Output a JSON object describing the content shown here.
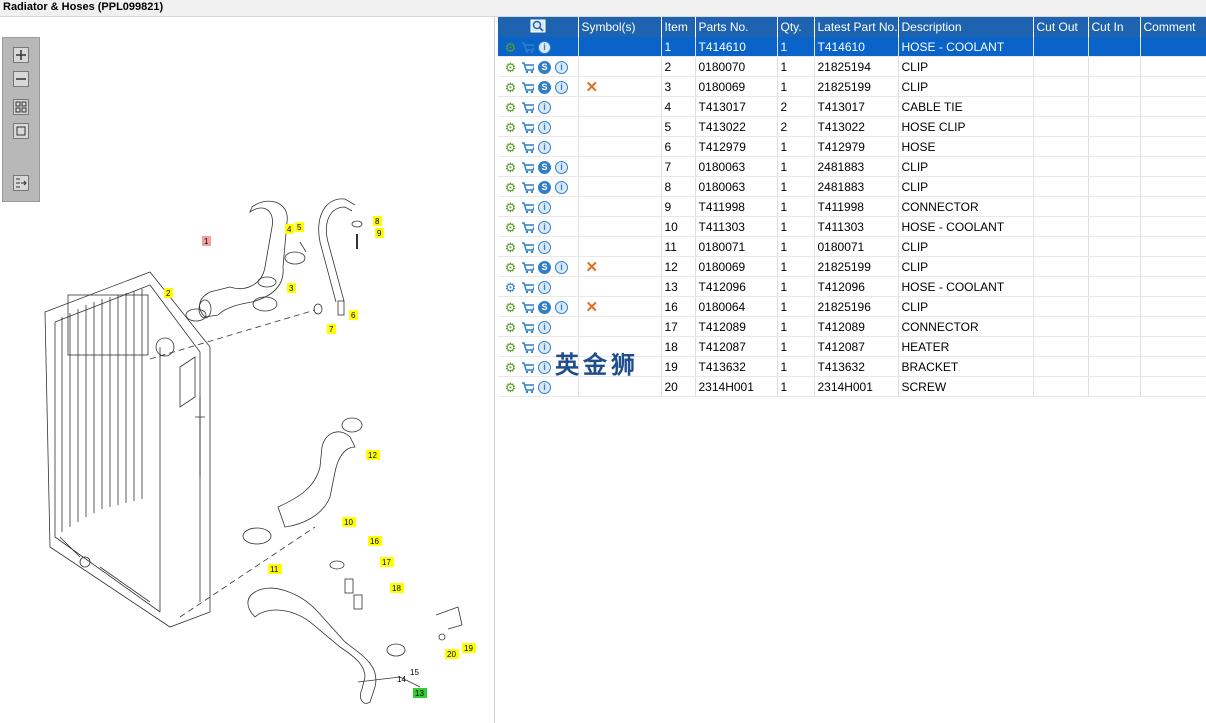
{
  "window": {
    "title": "Radiator & Hoses (PPL099821)"
  },
  "toolbox": [
    {
      "name": "zoom-in-button"
    },
    {
      "name": "zoom-out-button"
    },
    {
      "name": "fit-all-button"
    },
    {
      "name": "actual-size-button"
    },
    {
      "name": "export-button"
    }
  ],
  "drawing": {
    "callouts": [
      "1",
      "2",
      "3",
      "4",
      "5",
      "6",
      "7",
      "8",
      "9",
      "10",
      "11",
      "12",
      "13",
      "14",
      "15",
      "16",
      "17",
      "18",
      "19",
      "20"
    ]
  },
  "table": {
    "columns": [
      "",
      "Symbol(s)",
      "Item",
      "Parts No.",
      "Qty.",
      "Latest Part No.",
      "Description",
      "Cut Out",
      "Cut In",
      "Comment"
    ],
    "rows": [
      {
        "icons": [
          "gear",
          "cart",
          "info"
        ],
        "x": false,
        "item": "1",
        "part": "T414610",
        "qty": "1",
        "latest": "T414610",
        "desc": "HOSE - COOLANT",
        "selected": true
      },
      {
        "icons": [
          "gear",
          "cart",
          "s",
          "info"
        ],
        "x": false,
        "item": "2",
        "part": "0180070",
        "qty": "1",
        "latest": "21825194",
        "desc": "CLIP"
      },
      {
        "icons": [
          "gear",
          "cart",
          "s",
          "info"
        ],
        "x": true,
        "item": "3",
        "part": "0180069",
        "qty": "1",
        "latest": "21825199",
        "desc": "CLIP"
      },
      {
        "icons": [
          "gear",
          "cart",
          "info"
        ],
        "x": false,
        "item": "4",
        "part": "T413017",
        "qty": "2",
        "latest": "T413017",
        "desc": "CABLE TIE"
      },
      {
        "icons": [
          "gear",
          "cart",
          "info"
        ],
        "x": false,
        "item": "5",
        "part": "T413022",
        "qty": "2",
        "latest": "T413022",
        "desc": "HOSE CLIP"
      },
      {
        "icons": [
          "gear",
          "cart",
          "info"
        ],
        "x": false,
        "item": "6",
        "part": "T412979",
        "qty": "1",
        "latest": "T412979",
        "desc": "HOSE"
      },
      {
        "icons": [
          "gear",
          "cart",
          "s",
          "info"
        ],
        "x": false,
        "item": "7",
        "part": "0180063",
        "qty": "1",
        "latest": "2481883",
        "desc": "CLIP"
      },
      {
        "icons": [
          "gear",
          "cart",
          "s",
          "info"
        ],
        "x": false,
        "item": "8",
        "part": "0180063",
        "qty": "1",
        "latest": "2481883",
        "desc": "CLIP"
      },
      {
        "icons": [
          "gear",
          "cart",
          "info"
        ],
        "x": false,
        "item": "9",
        "part": "T411998",
        "qty": "1",
        "latest": "T411998",
        "desc": "CONNECTOR"
      },
      {
        "icons": [
          "gear",
          "cart",
          "info"
        ],
        "x": false,
        "item": "10",
        "part": "T411303",
        "qty": "1",
        "latest": "T411303",
        "desc": "HOSE - COOLANT"
      },
      {
        "icons": [
          "gear",
          "cart",
          "info"
        ],
        "x": false,
        "item": "11",
        "part": "0180071",
        "qty": "1",
        "latest": "0180071",
        "desc": "CLIP"
      },
      {
        "icons": [
          "gear",
          "cart",
          "s",
          "info"
        ],
        "x": true,
        "item": "12",
        "part": "0180069",
        "qty": "1",
        "latest": "21825199",
        "desc": "CLIP"
      },
      {
        "icons": [
          "gears",
          "cart",
          "info"
        ],
        "x": false,
        "item": "13",
        "part": "T412096",
        "qty": "1",
        "latest": "T412096",
        "desc": "HOSE - COOLANT"
      },
      {
        "icons": [
          "gear",
          "cart",
          "s",
          "info"
        ],
        "x": true,
        "item": "16",
        "part": "0180064",
        "qty": "1",
        "latest": "21825196",
        "desc": "CLIP"
      },
      {
        "icons": [
          "gear",
          "cart",
          "info"
        ],
        "x": false,
        "item": "17",
        "part": "T412089",
        "qty": "1",
        "latest": "T412089",
        "desc": "CONNECTOR"
      },
      {
        "icons": [
          "gear",
          "cart",
          "info"
        ],
        "x": false,
        "item": "18",
        "part": "T412087",
        "qty": "1",
        "latest": "T412087",
        "desc": "HEATER"
      },
      {
        "icons": [
          "gear",
          "cart",
          "info"
        ],
        "x": false,
        "item": "19",
        "part": "T413632",
        "qty": "1",
        "latest": "T413632",
        "desc": "BRACKET"
      },
      {
        "icons": [
          "gear",
          "cart",
          "info"
        ],
        "x": false,
        "item": "20",
        "part": "2314H001",
        "qty": "1",
        "latest": "2314H001",
        "desc": "SCREW"
      }
    ]
  },
  "watermark": "英金狮",
  "colors": {
    "header": "#1e63b0",
    "selected": "#0a63c9",
    "callout": "#ffff00",
    "callout_selected": "#f4a0a0",
    "callout_13": "#33cc33",
    "cross": "#e07020"
  }
}
